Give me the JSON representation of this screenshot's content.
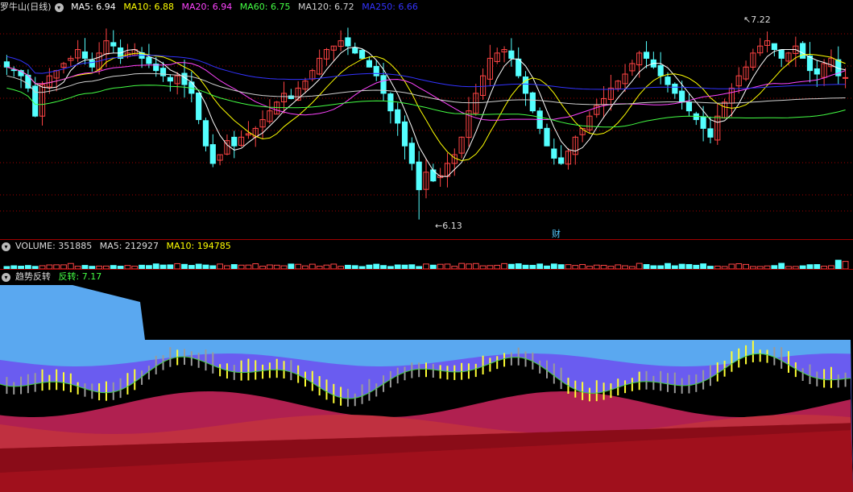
{
  "price_header": {
    "stock_name": "罗牛山(日线)",
    "ma5": "MA5: 6.94",
    "ma10": "MA10: 6.88",
    "ma20": "MA20: 6.94",
    "ma60": "MA60: 6.75",
    "ma120": "MA120: 6.72",
    "ma250": "MA250: 6.66"
  },
  "volume_header": {
    "volume": "VOLUME: 351885",
    "ma5": "MA5: 212927",
    "ma10": "MA10: 194785"
  },
  "indicator_header": {
    "name": "趋势反转",
    "value": "反转: 7.17"
  },
  "annotations": {
    "high_label": "7.22",
    "low_label": "6.13",
    "finance_marker": "财"
  },
  "colors": {
    "up": "#ff4444",
    "down": "#54ffff",
    "ma5": "#ffffff",
    "ma10": "#ffff00",
    "ma20": "#ff44ff",
    "ma60": "#44ff44",
    "ma120": "#d0d0d0",
    "ma250": "#3333ff",
    "grid": "#a00000"
  },
  "chart_data": [
    {
      "type": "candlestick",
      "title": "罗牛山(日线)",
      "ylim": [
        6.05,
        7.3
      ],
      "series": [
        {
          "name": "MA5",
          "last": 6.94
        },
        {
          "name": "MA10",
          "last": 6.88
        },
        {
          "name": "MA20",
          "last": 6.94
        },
        {
          "name": "MA60",
          "last": 6.75
        },
        {
          "name": "MA120",
          "last": 6.72
        },
        {
          "name": "MA250",
          "last": 6.66
        }
      ],
      "close": [
        7.0,
        6.98,
        6.95,
        6.88,
        6.72,
        6.9,
        6.95,
        6.98,
        7.02,
        7.05,
        7.1,
        7.05,
        7.0,
        7.08,
        7.15,
        7.12,
        7.05,
        7.08,
        7.1,
        7.05,
        7.02,
        6.98,
        6.95,
        6.92,
        6.95,
        6.9,
        6.85,
        6.7,
        6.55,
        6.45,
        6.5,
        6.58,
        6.55,
        6.6,
        6.62,
        6.65,
        6.7,
        6.75,
        6.8,
        6.85,
        6.82,
        6.88,
        6.92,
        6.98,
        7.05,
        7.1,
        7.12,
        7.15,
        7.12,
        7.08,
        7.05,
        7.0,
        6.95,
        6.85,
        6.75,
        6.68,
        6.55,
        6.45,
        6.3,
        6.4,
        6.35,
        6.38,
        6.45,
        6.5,
        6.6,
        6.75,
        6.85,
        6.95,
        7.05,
        7.08,
        7.1,
        7.05,
        6.95,
        6.85,
        6.75,
        6.65,
        6.55,
        6.48,
        6.45,
        6.52,
        6.6,
        6.65,
        6.72,
        6.78,
        6.82,
        6.88,
        6.92,
        6.96,
        7.02,
        7.08,
        7.05,
        7.0,
        6.95,
        6.9,
        6.85,
        6.8,
        6.75,
        6.7,
        6.65,
        6.6,
        6.72,
        6.8,
        6.88,
        6.95,
        7.0,
        7.08,
        7.12,
        7.15,
        7.1,
        7.05,
        7.08,
        7.12,
        7.05,
        6.98,
        6.96,
        7.02,
        7.05,
        6.95,
        6.94
      ],
      "x_annotations": {
        "high": 7.22,
        "low": 6.13
      }
    },
    {
      "type": "bar",
      "title": "VOLUME",
      "series": [
        {
          "name": "VOLUME",
          "last": 351885
        },
        {
          "name": "MA5",
          "last": 212927
        },
        {
          "name": "MA10",
          "last": 194785
        }
      ]
    },
    {
      "type": "area",
      "title": "趋势反转",
      "series": [
        {
          "name": "反转",
          "last": 7.17
        }
      ]
    }
  ]
}
